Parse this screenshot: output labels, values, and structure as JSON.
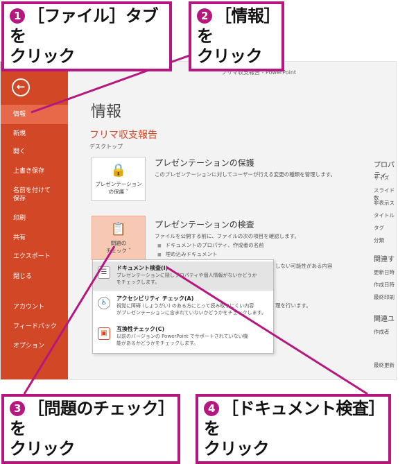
{
  "callouts": [
    {
      "num": "1",
      "text1": "［ファイル］タブを",
      "text2": "クリック"
    },
    {
      "num": "2",
      "text1": "［情報］を",
      "text2": "クリック"
    },
    {
      "num": "3",
      "text1": "［問題のチェック］を",
      "text2": "クリック"
    },
    {
      "num": "4",
      "text1": "［ドキュメント検査］を",
      "text2": "クリック"
    }
  ],
  "window_title": "フリマ収支報告 - PowerPoint",
  "sidebar": {
    "back_icon": "back-arrow-icon",
    "items": [
      "情報",
      "新規",
      "開く",
      "上書き保存",
      "名前を付けて",
      "保存",
      "印刷",
      "共有",
      "エクスポート",
      "閉じる",
      "アカウント",
      "フィードバック",
      "オプション"
    ]
  },
  "main": {
    "title": "情報",
    "doc_name": "フリマ収支報告",
    "doc_location": "デスクトップ",
    "protect": {
      "tile_line1": "プレゼンテーション",
      "tile_line2": "の保護 ˅",
      "title": "プレゼンテーションの保護",
      "desc": "このプレゼンテーションに対してユーザーが行える変更の種類を管理します。"
    },
    "inspect": {
      "tile_line1": "問題の",
      "tile_line2": "チェック ˅",
      "title": "プレゼンテーションの検査",
      "desc": "ファイルを公開する前に、ファイルの次の項目を確認します。",
      "bullets": [
        "ドキュメントのプロパティ、作成者の名前",
        "埋め込みドキュメント"
      ],
      "partial1": "しない可能性がある内容",
      "partial2": "理を行います。"
    }
  },
  "properties": {
    "head": "プロパティ",
    "items": [
      "サイズ",
      "スライド数",
      "非表示ス",
      "タイトル",
      "タグ",
      "分類"
    ],
    "related_dates_head": "関連す",
    "dates": [
      "更新日時",
      "作成日時",
      "最終印刷"
    ],
    "related_people_head": "関連ユ",
    "people": [
      "作成者"
    ],
    "last_modified": "最終更新"
  },
  "dropdown": {
    "items": [
      {
        "title": "ドキュメント検査(I)",
        "desc1": "プレゼンテーションに隠しプロパティや個人情報がないかどうか",
        "desc2": "をチェックします。",
        "icon": "document-inspect-icon"
      },
      {
        "title": "アクセシビリティ チェック(A)",
        "desc1": "視覚に障碍 (しょうがい) のある方にとって読み取りにくい内容",
        "desc2": "がプレゼンテーションに含まれていないかどうかをチェックします。",
        "icon": "accessibility-icon"
      },
      {
        "title": "互換性チェック(C)",
        "desc1": "以前のバージョンの PowerPoint でサポートされていない機",
        "desc2": "能があるかどうかをチェックします。",
        "icon": "compatibility-icon"
      }
    ]
  },
  "colors": {
    "accent": "#d24726",
    "callout": "#b5177e"
  }
}
